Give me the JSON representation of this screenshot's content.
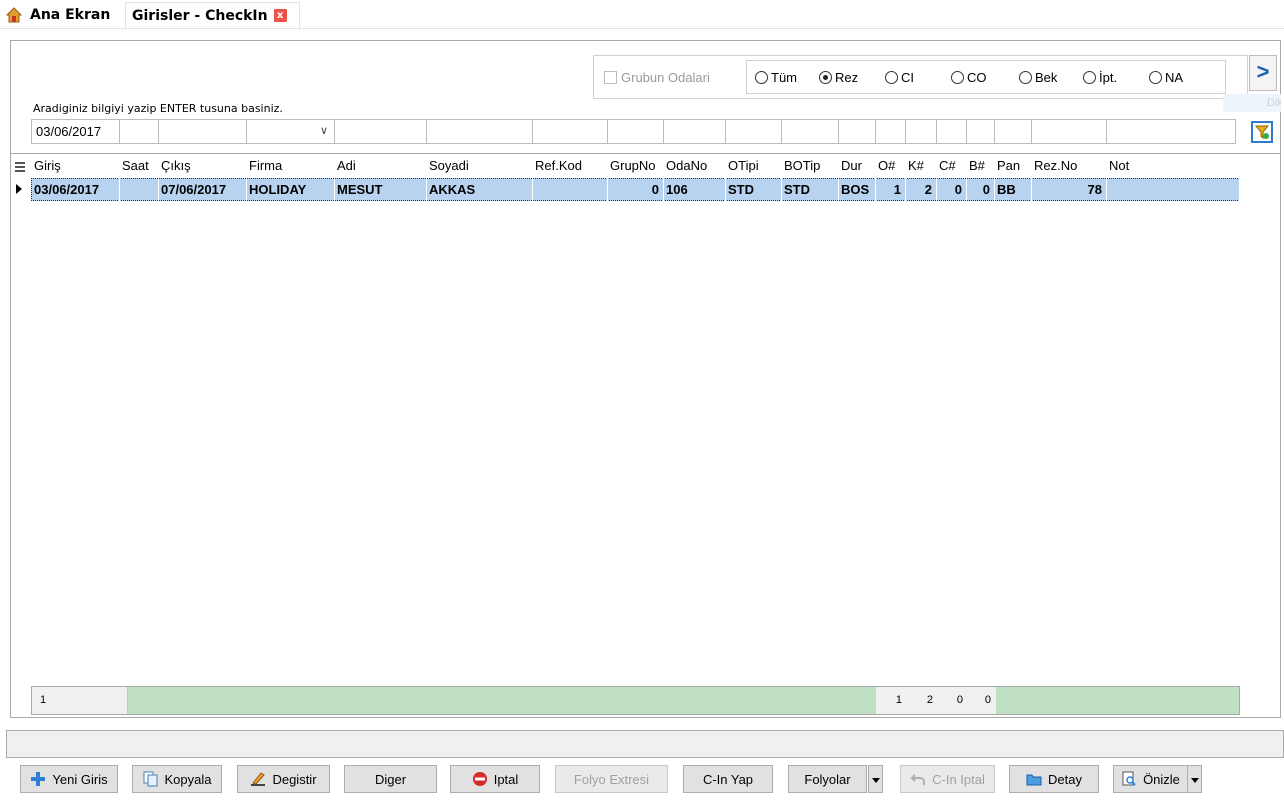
{
  "tabs": [
    {
      "label": "Ana Ekran",
      "icon": "home-icon"
    },
    {
      "label": "Girisler - CheckIn",
      "icon": "close-icon",
      "close": "x"
    }
  ],
  "filters": {
    "group_rooms": "Grubun Odalari",
    "status_options": [
      {
        "label": "Tüm",
        "selected": false
      },
      {
        "label": "Rez",
        "selected": true
      },
      {
        "label": "CI",
        "selected": false
      },
      {
        "label": "CO",
        "selected": false
      },
      {
        "label": "Bek",
        "selected": false
      },
      {
        "label": "İpt.",
        "selected": false
      },
      {
        "label": "NA",
        "selected": false
      }
    ],
    "next_label": ">",
    "faded_label": "Dikdo",
    "hint": "Aradiginiz bilgiyi yazip ENTER tusuna basiniz.",
    "date_value": "03/06/2017",
    "dropdown_arrow": "∨"
  },
  "grid": {
    "columns": [
      "Giriş",
      "Saat",
      "Çıkış",
      "Firma",
      "Adi",
      "Soyadi",
      "Ref.Kod",
      "GrupNo",
      "OdaNo",
      "OTipi",
      "BOTip",
      "Dur",
      "O#",
      "K#",
      "C#",
      "B#",
      "Pan",
      "Rez.No",
      "Not"
    ],
    "rows": [
      {
        "giris": "03/06/2017",
        "saat": "",
        "cikis": "07/06/2017",
        "firma": "HOLIDAY",
        "adi": "MESUT",
        "soyadi": "AKKAS",
        "refkod": "",
        "grupno": "0",
        "odano": "106",
        "otipi": "STD",
        "botip": "STD",
        "dur": "BOS",
        "o": "1",
        "k": "2",
        "c": "0",
        "b": "0",
        "pan": "BB",
        "rezno": "78",
        "not": ""
      }
    ]
  },
  "footer": {
    "count": "1",
    "o": "1",
    "k": "2",
    "c": "0",
    "b": "0"
  },
  "buttons": {
    "new": "Yeni Giris",
    "copy": "Kopyala",
    "change": "Degistir",
    "other": "Diger",
    "cancel": "Iptal",
    "folio_extract": "Folyo Extresi",
    "checkin": "C-In Yap",
    "folios": "Folyolar",
    "checkin_cancel": "C-In Iptal",
    "detail": "Detay",
    "preview": "Önizle"
  },
  "colors": {
    "selection": "#b7d3f0",
    "footer": "#bfe0c3",
    "accent": "#1c5fb0",
    "close": "#e8534a"
  }
}
